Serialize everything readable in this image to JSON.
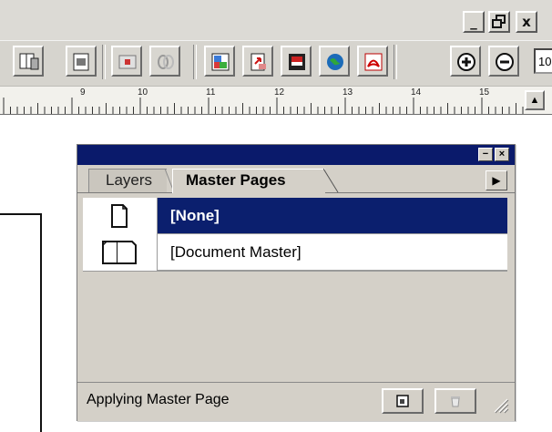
{
  "window_controls": {
    "minimize": "_",
    "restore": "❐",
    "close": "x"
  },
  "toolbar": {
    "buttons": [
      "pages-icon",
      "export-icon",
      "frame-icon",
      "link-icon",
      "image-icon",
      "pdf-export-icon",
      "preview-icon",
      "globe-icon",
      "acrobat-icon",
      "zoom-in-icon",
      "zoom-out-icon"
    ],
    "zoom_value": "10"
  },
  "ruler": {
    "ticks": [
      "9",
      "10",
      "11",
      "12",
      "13",
      "14",
      "15"
    ],
    "scroll_up": "▲"
  },
  "palette": {
    "tabs": {
      "inactive": "Layers",
      "active": "Master Pages"
    },
    "menu_arrow": "▶",
    "title_buttons": {
      "minimize": "−",
      "close": "×"
    },
    "items": [
      {
        "label": "[None]",
        "icon": "single-page-icon",
        "selected": true
      },
      {
        "label": "[Document Master]",
        "icon": "spread-page-icon",
        "selected": false
      }
    ],
    "status_text": "Applying Master Page",
    "footer_buttons": [
      "new-master-icon",
      "trash-icon"
    ]
  }
}
